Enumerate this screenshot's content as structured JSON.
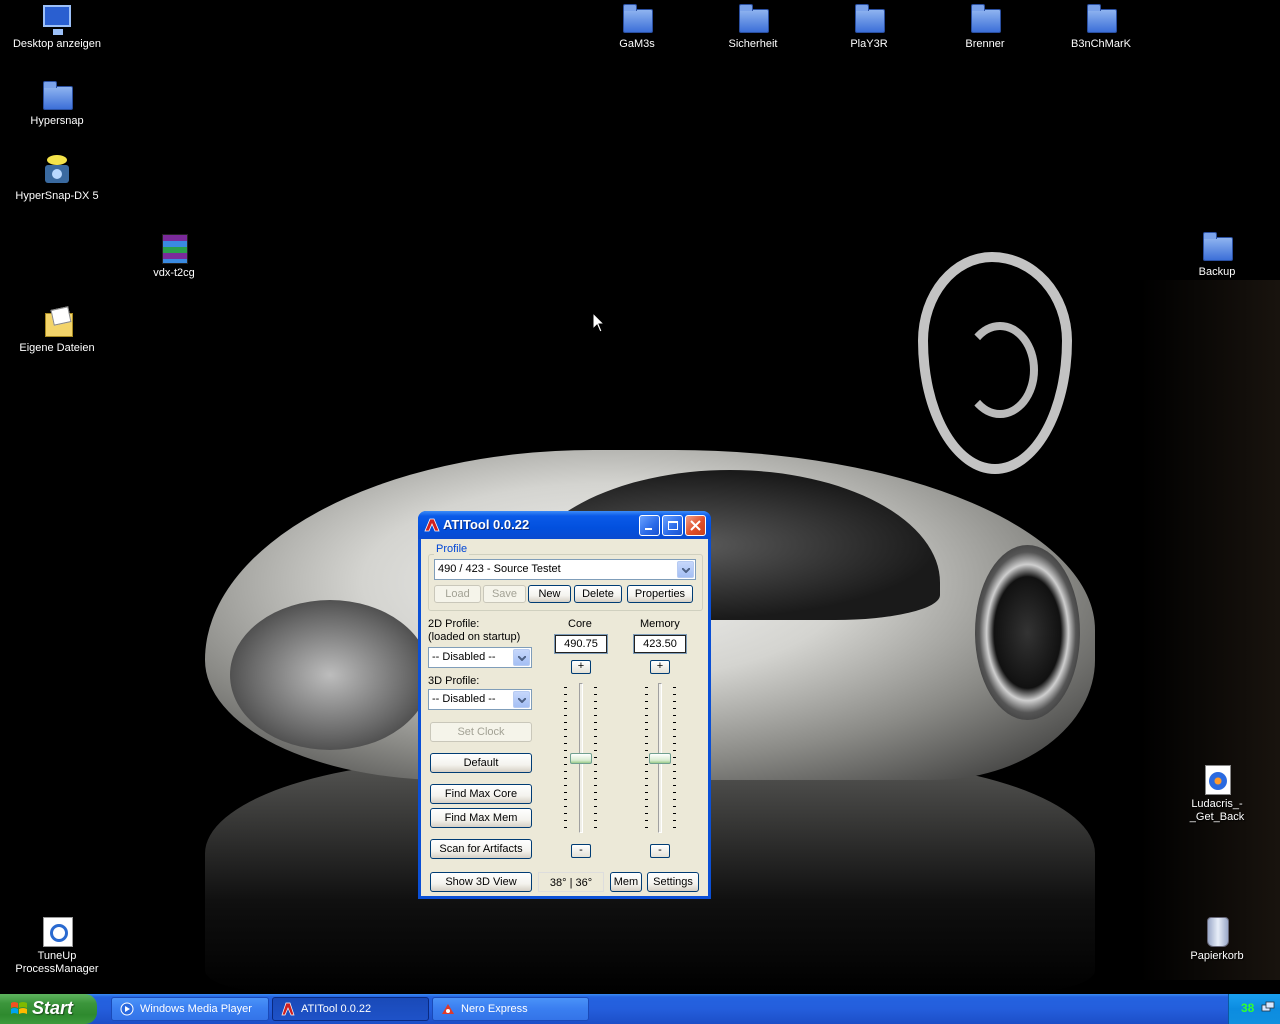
{
  "desktop": {
    "icons": [
      {
        "label": "Desktop anzeigen",
        "icon": "show-desktop-icon"
      },
      {
        "label": "Hypersnap",
        "icon": "folder-icon"
      },
      {
        "label": "HyperSnap-DX 5",
        "icon": "camera-icon"
      },
      {
        "label": "vdx-t2cg",
        "icon": "winrar-archive-icon"
      },
      {
        "label": "Eigene Dateien",
        "icon": "my-documents-icon"
      },
      {
        "label": "GaM3s",
        "icon": "folder-icon"
      },
      {
        "label": "Sicherheit",
        "icon": "folder-icon"
      },
      {
        "label": "PlaY3R",
        "icon": "folder-icon"
      },
      {
        "label": "Brenner",
        "icon": "folder-icon"
      },
      {
        "label": "B3nChMarK",
        "icon": "folder-icon"
      },
      {
        "label": "Backup",
        "icon": "folder-icon"
      },
      {
        "label": "Ludacris_-_Get_Back",
        "icon": "media-file-icon"
      },
      {
        "label": "TuneUp\nProcessManager",
        "line1": "TuneUp",
        "line2": "ProcessManager",
        "icon": "tuneup-icon"
      },
      {
        "label": "Papierkorb",
        "icon": "recycle-bin-icon"
      }
    ]
  },
  "window": {
    "title": "ATITool 0.0.22",
    "profile": {
      "group_label": "Profile",
      "selected": "490 / 423 - Source Testet",
      "buttons": {
        "load": "Load",
        "save": "Save",
        "new": "New",
        "delete": "Delete",
        "properties": "Properties"
      }
    },
    "profile_2d": {
      "label_line1": "2D Profile:",
      "label_line2": "(loaded on startup)",
      "selected": "-- Disabled --"
    },
    "profile_3d": {
      "label": "3D Profile:",
      "selected": "-- Disabled --"
    },
    "core": {
      "label": "Core",
      "value": "490.75",
      "plus": "+",
      "minus": "-",
      "slider_fraction": 0.5
    },
    "memory": {
      "label": "Memory",
      "value": "423.50",
      "plus": "+",
      "minus": "-",
      "slider_fraction": 0.5
    },
    "buttons": {
      "set_clock": "Set Clock",
      "default": "Default",
      "find_max_core": "Find Max Core",
      "find_max_mem": "Find Max Mem",
      "scan_artifacts": "Scan for Artifacts",
      "show_3d_view": "Show 3D View",
      "mem": "Mem",
      "settings": "Settings"
    },
    "temperature": "38° | 36°"
  },
  "taskbar": {
    "start_label": "Start",
    "tasks": [
      {
        "label": "Windows Media Player",
        "icon": "wmp-icon",
        "active": false
      },
      {
        "label": "ATITool 0.0.22",
        "icon": "atitool-icon",
        "active": true
      },
      {
        "label": "Nero Express",
        "icon": "nero-icon",
        "active": false
      }
    ],
    "tray": {
      "temperature": "38"
    }
  },
  "colors": {
    "titlebar": "#0250de",
    "window_face": "#ece9d8",
    "taskbar": "#245edc",
    "start_green": "#3c963c",
    "tray_temp": "#30ff30"
  }
}
